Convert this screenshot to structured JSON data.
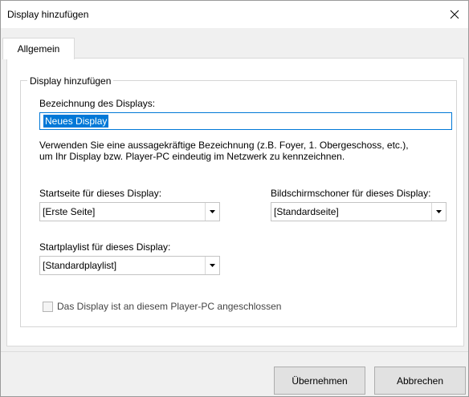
{
  "dialog": {
    "title": "Display hinzufügen",
    "close_icon": "close-icon"
  },
  "tabs": [
    {
      "label": "Allgemein",
      "active": true
    }
  ],
  "group": {
    "legend": "Display hinzufügen",
    "name_label": "Bezeichnung des Displays:",
    "name_value": "Neues Display",
    "hint_line1": "Verwenden Sie eine aussagekräftige Bezeichnung (z.B. Foyer, 1. Obergeschoss, etc.),",
    "hint_line2": "um Ihr Display bzw. Player-PC eindeutig im Netzwerk zu kennzeichnen.",
    "startpage_label": "Startseite für dieses Display:",
    "startpage_value": "[Erste Seite]",
    "screensaver_label": "Bildschirmschoner für dieses Display:",
    "screensaver_value": "[Standardseite]",
    "playlist_label": "Startplaylist für dieses Display:",
    "playlist_value": "[Standardplaylist]",
    "checkbox_label": "Das Display ist an diesem Player-PC angeschlossen",
    "checkbox_checked": false
  },
  "buttons": {
    "apply": "Übernehmen",
    "cancel": "Abbrechen"
  },
  "colors": {
    "accent": "#0078d7",
    "window_bg": "#f0f0f0",
    "panel_bg": "#ffffff"
  }
}
